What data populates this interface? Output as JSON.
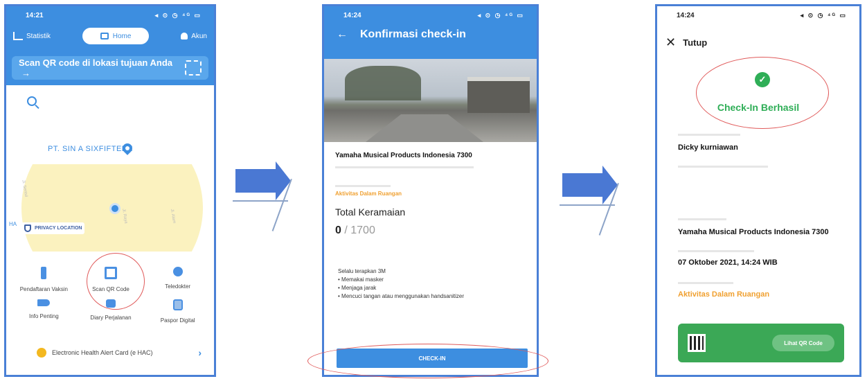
{
  "phone1": {
    "time": "14:21",
    "status_icons": "◂ ⊙ ◷ ⁴ᴳ ▭",
    "nav": {
      "statistik": "Statistik",
      "home": "Home",
      "akun": "Akun"
    },
    "scan_bar": "Scan QR code di lokasi tujuan Anda",
    "scan_arrow": "→",
    "map": {
      "place_label": "PT. SIN A SIXFIFTEEN",
      "privacy_label": "PRIVACY LOCATION",
      "ha_tag": "HA"
    },
    "menu": [
      {
        "label": "Pendaftaran Vaksin"
      },
      {
        "label": "Scan QR Code"
      },
      {
        "label": "Teledokter"
      },
      {
        "label": "Info Penting"
      },
      {
        "label": "Diary Perjalanan"
      },
      {
        "label": "Paspor Digital"
      }
    ],
    "ehac_label": "Electronic Health Alert Card (e HAC)",
    "ehac_chevron": "›"
  },
  "phone2": {
    "time": "14:24",
    "status_icons": "◂ ⊙ ◷ ⁴ᴳ ▭",
    "back": "←",
    "title": "Konfirmasi check-in",
    "venue": "Yamaha Musical Products Indonesia  7300",
    "category_value": "Aktivitas Dalam Ruangan",
    "crowd_title": "Total Keramaian",
    "crowd_count": "0",
    "crowd_capacity": " / 1700",
    "tips": [
      "Selalu terapkan 3M",
      "• Memakai masker",
      "• Menjaga jarak",
      "• Mencuci tangan atau menggunakan handsanitizer"
    ],
    "button": "CHECK-IN"
  },
  "phone3": {
    "time": "14:24",
    "status_icons": "◂ ⊙ ◷ ⁴ᴳ ▭",
    "close_x": "✕",
    "close_label": "Tutup",
    "check_mark": "✓",
    "success": "Check-In Berhasil",
    "name_value": "Dicky kurniawan",
    "venue_value": "Yamaha Musical Products Indonesia  7300",
    "datetime_value": "07 Oktober 2021, 14:24 WIB",
    "category_value": "Aktivitas Dalam Ruangan",
    "qr_button": "Lihat QR Code"
  },
  "colors": {
    "primary_blue": "#3d8ee0",
    "success_green": "#2fae57",
    "accent_orange": "#f0a030",
    "highlight_red": "#e05a5a",
    "arrow_blue": "#4a78d3"
  },
  "icons": [
    "statistik-icon",
    "home-icon",
    "account-icon",
    "scan-qr-icon",
    "search-icon",
    "location-pin-icon",
    "shield-icon",
    "vaccine-icon",
    "qr-code-icon",
    "stethoscope-icon",
    "megaphone-icon",
    "diary-icon",
    "passport-icon",
    "ehac-icon",
    "chevron-right-icon",
    "back-arrow-icon",
    "close-icon",
    "check-circle-icon",
    "qr-thumbnail-icon"
  ]
}
